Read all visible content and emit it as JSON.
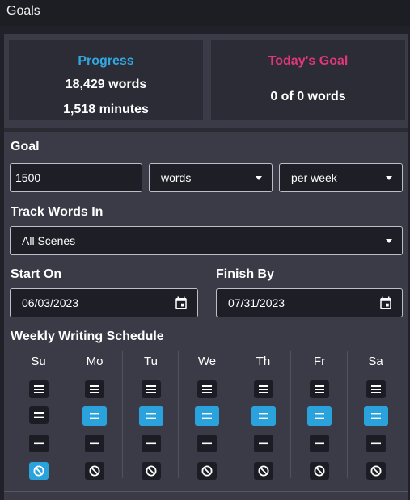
{
  "window": {
    "title": "Goals"
  },
  "progress": {
    "title": "Progress",
    "words": "18,429 words",
    "minutes": "1,518 minutes"
  },
  "today": {
    "title": "Today's Goal",
    "words": "0 of 0 words"
  },
  "goal": {
    "label": "Goal",
    "amount": "1500",
    "unit": "words",
    "period": "per week"
  },
  "track": {
    "label": "Track Words In",
    "value": "All Scenes"
  },
  "start": {
    "label": "Start On",
    "value": "06/03/2023"
  },
  "finish": {
    "label": "Finish By",
    "value": "07/31/2023"
  },
  "schedule": {
    "label": "Weekly Writing Schedule",
    "levels": [
      "high",
      "normal",
      "low",
      "none"
    ],
    "days": [
      {
        "name": "Su",
        "selected": "none"
      },
      {
        "name": "Mo",
        "selected": "normal"
      },
      {
        "name": "Tu",
        "selected": "normal"
      },
      {
        "name": "We",
        "selected": "normal"
      },
      {
        "name": "Th",
        "selected": "normal"
      },
      {
        "name": "Fr",
        "selected": "normal"
      },
      {
        "name": "Sa",
        "selected": "normal"
      }
    ]
  },
  "colors": {
    "accent": "#2aa3dd",
    "progress_title": "#32a7e0",
    "today_title": "#e0367a"
  },
  "icons": {
    "dropdown": "caret-down-icon",
    "date": "calendar-icon",
    "high": "three-lines-icon",
    "normal": "two-lines-icon",
    "low": "one-line-icon",
    "none": "block-icon"
  }
}
